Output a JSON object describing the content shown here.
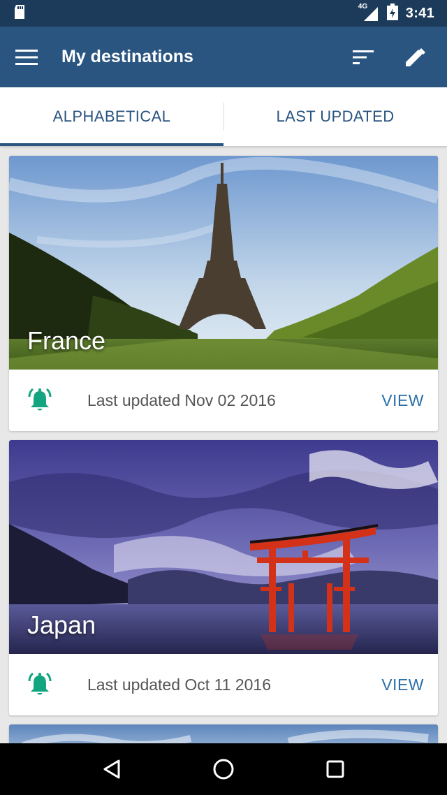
{
  "status_bar": {
    "network": "4G",
    "time": "3:41",
    "icons": [
      "sd-card-icon",
      "signal-icon",
      "battery-icon"
    ]
  },
  "app_bar": {
    "title": "My destinations",
    "icons": [
      "menu-icon",
      "sort-icon",
      "edit-icon"
    ]
  },
  "tabs": [
    {
      "label": "ALPHABETICAL",
      "active": true
    },
    {
      "label": "LAST UPDATED",
      "active": false
    }
  ],
  "destinations": [
    {
      "name": "France",
      "updated": "Last updated Nov 02 2016",
      "action": "VIEW"
    },
    {
      "name": "Japan",
      "updated": "Last updated Oct 11 2016",
      "action": "VIEW"
    }
  ],
  "colors": {
    "status_bar": "#1c3a59",
    "app_bar": "#2a5580",
    "accent": "#2a6fa8",
    "bell": "#13a57f"
  },
  "nav_bar": {
    "icons": [
      "back-icon",
      "home-icon",
      "recents-icon"
    ]
  }
}
